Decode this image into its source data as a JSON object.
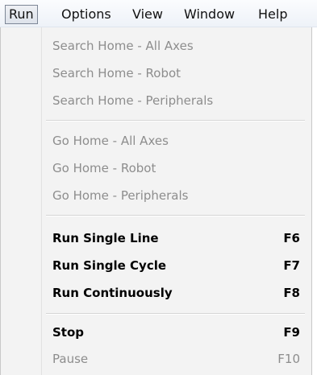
{
  "menubar": {
    "items": [
      {
        "label": "Run",
        "active": true
      },
      {
        "label": "Options"
      },
      {
        "label": "View"
      },
      {
        "label": "Window"
      },
      {
        "label": "Help"
      }
    ]
  },
  "run_menu": {
    "groups": [
      {
        "items": [
          {
            "label": "Search Home - All Axes",
            "enabled": false
          },
          {
            "label": "Search Home - Robot",
            "enabled": false
          },
          {
            "label": "Search Home - Peripherals",
            "enabled": false
          }
        ]
      },
      {
        "items": [
          {
            "label": "Go Home - All Axes",
            "enabled": false
          },
          {
            "label": "Go Home - Robot",
            "enabled": false
          },
          {
            "label": "Go Home - Peripherals",
            "enabled": false
          }
        ]
      },
      {
        "items": [
          {
            "label": "Run Single Line",
            "shortcut": "F6",
            "enabled": true
          },
          {
            "label": "Run Single Cycle",
            "shortcut": "F7",
            "enabled": true
          },
          {
            "label": "Run Continuously",
            "shortcut": "F8",
            "enabled": true
          }
        ]
      },
      {
        "items": [
          {
            "label": "Stop",
            "shortcut": "F9",
            "enabled": true
          },
          {
            "label": "Pause",
            "shortcut": "F10",
            "enabled": false
          }
        ]
      }
    ]
  }
}
